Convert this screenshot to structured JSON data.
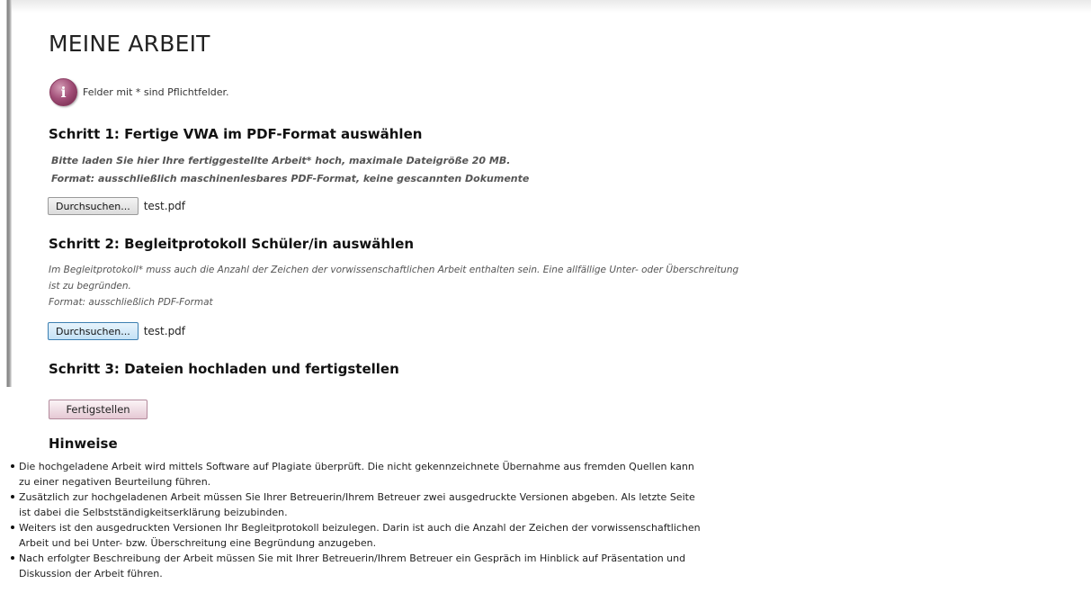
{
  "page": {
    "title": "MEINE ARBEIT",
    "info_text": "Felder mit * sind Pflichtfelder."
  },
  "step1": {
    "heading": "Schritt 1: Fertige VWA im PDF-Format auswählen",
    "note_line1": "Bitte laden Sie hier Ihre fertiggestellte Arbeit* hoch, maximale Dateigröße 20 MB.",
    "note_line2": "Format: ausschließlich maschinenlesbares PDF-Format, keine gescannten Dokumente",
    "browse_label": "Durchsuchen...",
    "file_name": "test.pdf"
  },
  "step2": {
    "heading": "Schritt 2: Begleitprotokoll Schüler/in auswählen",
    "note_line1": "Im Begleitprotokoll* muss auch die Anzahl der Zeichen der vorwissenschaftlichen Arbeit enthalten sein. Eine allfällige Unter- oder Überschreitung",
    "note_line2": "ist zu begründen.",
    "note_line3": "Format: ausschließlich PDF-Format",
    "browse_label": "Durchsuchen...",
    "file_name": "test.pdf"
  },
  "step3": {
    "heading": "Schritt 3: Dateien hochladen und fertigstellen",
    "finish_label": "Fertigstellen"
  },
  "hints": {
    "title": "Hinweise",
    "items": [
      {
        "line1": "Die hochgeladene Arbeit wird mittels Software auf Plagiate überprüft. Die nicht gekennzeichnete Übernahme aus fremden Quellen kann",
        "line2": "zu einer negativen Beurteilung führen."
      },
      {
        "line1": "Zusätzlich zur hochgeladenen Arbeit müssen Sie Ihrer Betreuerin/Ihrem Betreuer zwei ausgedruckte Versionen abgeben. Als letzte Seite",
        "line2": "ist dabei die Selbstständigkeitserklärung beizubinden."
      },
      {
        "line1": "Weiters ist den ausgedruckten Versionen Ihr Begleitprotokoll beizulegen. Darin ist auch die Anzahl der Zeichen der vorwissenschaftlichen",
        "line2": "Arbeit und bei Unter- bzw. Überschreitung eine Begründung anzugeben."
      },
      {
        "line1": "Nach erfolgter Beschreibung der Arbeit müssen Sie mit Ihrer Betreuerin/Ihrem Betreuer ein Gespräch im Hinblick auf Präsentation und",
        "line2": "Diskussion der Arbeit führen."
      }
    ]
  },
  "colors": {
    "info_icon": "#a24f78",
    "finish_button": "#e5c9d4",
    "active_browse_button": "#c4e2f6"
  }
}
